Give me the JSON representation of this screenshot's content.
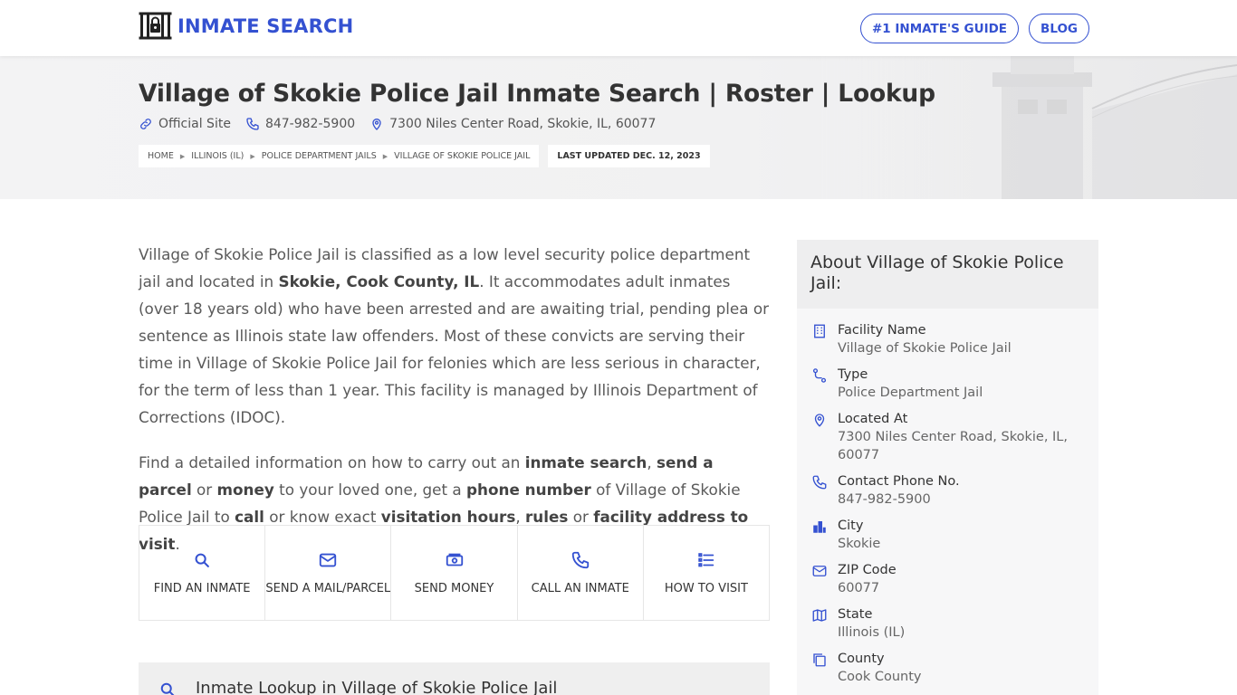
{
  "header": {
    "logo_text": "INMATE SEARCH",
    "nav": [
      {
        "label": "#1 INMATE'S GUIDE"
      },
      {
        "label": "BLOG"
      }
    ]
  },
  "hero": {
    "title": "Village of Skokie Police Jail Inmate Search | Roster | Lookup",
    "official_site": "Official Site",
    "phone": "847-982-5900",
    "address": "7300 Niles Center Road, Skokie, IL, 60077",
    "breadcrumbs": [
      "HOME",
      "ILLINOIS (IL)",
      "POLICE DEPARTMENT JAILS",
      "VILLAGE OF SKOKIE POLICE JAIL"
    ],
    "last_updated": "LAST UPDATED DEC. 12, 2023"
  },
  "intro": {
    "p1_a": "Village of Skokie Police Jail is classified as a low level security police department jail and located in ",
    "p1_b": "Skokie, Cook County, IL",
    "p1_c": ". It accommodates adult inmates (over 18 years old) who have been arrested and are awaiting trial, pending plea or sentence as Illinois state law offenders. Most of these convicts are serving their time in Village of Skokie Police Jail for felonies which are less serious in character, for the term of less than 1 year. This facility is managed by Illinois Department of Corrections (IDOC).",
    "p2": [
      {
        "t": "Find a detailed information on how to carry out an ",
        "b": false
      },
      {
        "t": "inmate search",
        "b": true
      },
      {
        "t": ", ",
        "b": false
      },
      {
        "t": "send a parcel",
        "b": true
      },
      {
        "t": " or ",
        "b": false
      },
      {
        "t": "money",
        "b": true
      },
      {
        "t": " to your loved one, get a ",
        "b": false
      },
      {
        "t": "phone number",
        "b": true
      },
      {
        "t": " of Village of Skokie Police Jail to ",
        "b": false
      },
      {
        "t": "call",
        "b": true
      },
      {
        "t": " or know exact ",
        "b": false
      },
      {
        "t": "visitation hours",
        "b": true
      },
      {
        "t": ", ",
        "b": false
      },
      {
        "t": "rules",
        "b": true
      },
      {
        "t": " or ",
        "b": false
      },
      {
        "t": "facility address to visit",
        "b": true
      },
      {
        "t": ".",
        "b": false
      }
    ]
  },
  "actions": [
    {
      "label": "FIND AN INMATE",
      "icon": "search-icon"
    },
    {
      "label": "SEND A MAIL/PARCEL",
      "icon": "mail-icon"
    },
    {
      "label": "SEND MONEY",
      "icon": "money-icon"
    },
    {
      "label": "CALL AN INMATE",
      "icon": "phone-icon"
    },
    {
      "label": "HOW TO VISIT",
      "icon": "list-icon"
    }
  ],
  "lookup": {
    "title": "Inmate Lookup in Village of Skokie Police Jail"
  },
  "sidebar": {
    "title": "About Village of Skokie Police Jail:",
    "items": [
      {
        "label": "Facility Name",
        "value": "Village of Skokie Police Jail",
        "icon": "building-icon"
      },
      {
        "label": "Type",
        "value": "Police Department Jail",
        "icon": "route-icon"
      },
      {
        "label": "Located At",
        "value": "7300 Niles Center Road, Skokie, IL, 60077",
        "icon": "map-pin-icon"
      },
      {
        "label": "Contact Phone No.",
        "value": "847-982-5900",
        "icon": "phone-icon"
      },
      {
        "label": "City",
        "value": "Skokie",
        "icon": "city-icon"
      },
      {
        "label": "ZIP Code",
        "value": "60077",
        "icon": "mail-icon"
      },
      {
        "label": "State",
        "value": "Illinois (IL)",
        "icon": "map-icon"
      },
      {
        "label": "County",
        "value": "Cook County",
        "icon": "copy-icon"
      }
    ]
  },
  "colors": {
    "accent": "#3451d1",
    "text_dark": "#333333",
    "hero_bg": "#f1f1f2"
  }
}
